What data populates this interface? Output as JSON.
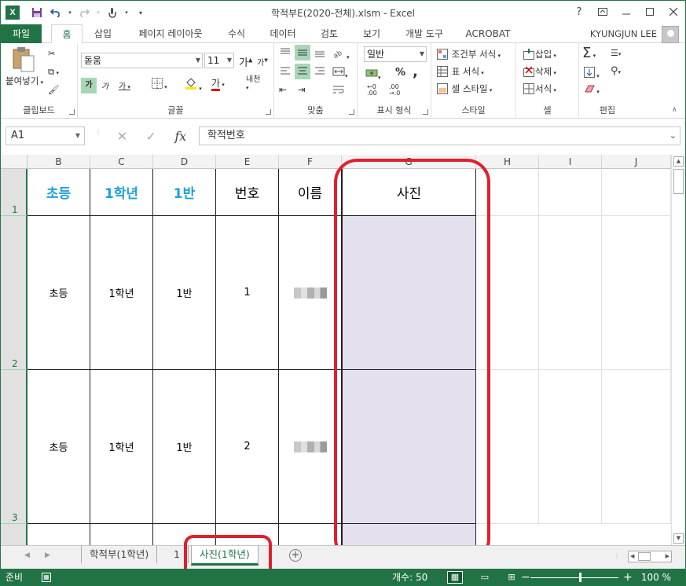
{
  "window": {
    "title": "학적부E(2020-전체).xlsm - Excel",
    "app_icon": "X",
    "help": "?",
    "qat": {
      "save": "save-icon",
      "undo": "undo-icon",
      "redo": "redo-icon",
      "touch": "touch-mode-icon"
    }
  },
  "tabs": {
    "file": "파일",
    "items": [
      "홈",
      "삽입",
      "페이지 레이아웃",
      "수식",
      "데이터",
      "검토",
      "보기",
      "개발 도구",
      "ACROBAT"
    ],
    "active": "홈",
    "user": "KYUNGJUN LEE"
  },
  "ribbon": {
    "clipboard": {
      "label": "클립보드",
      "paste": "붙여넣기"
    },
    "font": {
      "label": "글꼴",
      "font_name": "돋움",
      "font_size": "11",
      "bold": "가",
      "italic": "가",
      "underline": "가",
      "grow": "가",
      "shrink": "가",
      "phonetic": "내천",
      "font_color": "가"
    },
    "align": {
      "label": "맞춤"
    },
    "number": {
      "label": "표시 형식",
      "format": "일반",
      "percent": "%",
      "comma": ","
    },
    "styles": {
      "label": "스타일",
      "conditional": "조건부 서식",
      "table": "표 서식",
      "cell": "셀 스타일"
    },
    "cells": {
      "label": "셀",
      "insert": "삽입",
      "delete": "삭제",
      "format": "서식"
    },
    "editing": {
      "label": "편집"
    }
  },
  "formula_bar": {
    "name_box": "A1",
    "content": "학적번호",
    "fx": "fx"
  },
  "grid": {
    "columns": [
      "B",
      "C",
      "D",
      "E",
      "F",
      "G",
      "H",
      "I",
      "J"
    ],
    "rows": [
      "1",
      "2",
      "3"
    ],
    "header_row": [
      "초등",
      "1학년",
      "1반",
      "번호",
      "이름",
      "사진"
    ],
    "data_rows": [
      [
        "초등",
        "1학년",
        "1반",
        "1"
      ],
      [
        "초등",
        "1학년",
        "1반",
        "2"
      ]
    ],
    "photo_fill": "#e4e0ee",
    "header_accent": "#1ea0d8"
  },
  "sheets": {
    "tabs": [
      "학적부(1학년)",
      "1",
      "사진(1학년)"
    ],
    "active": "사진(1학년)"
  },
  "status": {
    "ready": "준비",
    "count": "개수: 50",
    "zoom": "100 %",
    "zoom_minus": "−",
    "zoom_plus": "+"
  },
  "colors": {
    "excel_green": "#217346",
    "highlight_red": "#e0202a"
  }
}
